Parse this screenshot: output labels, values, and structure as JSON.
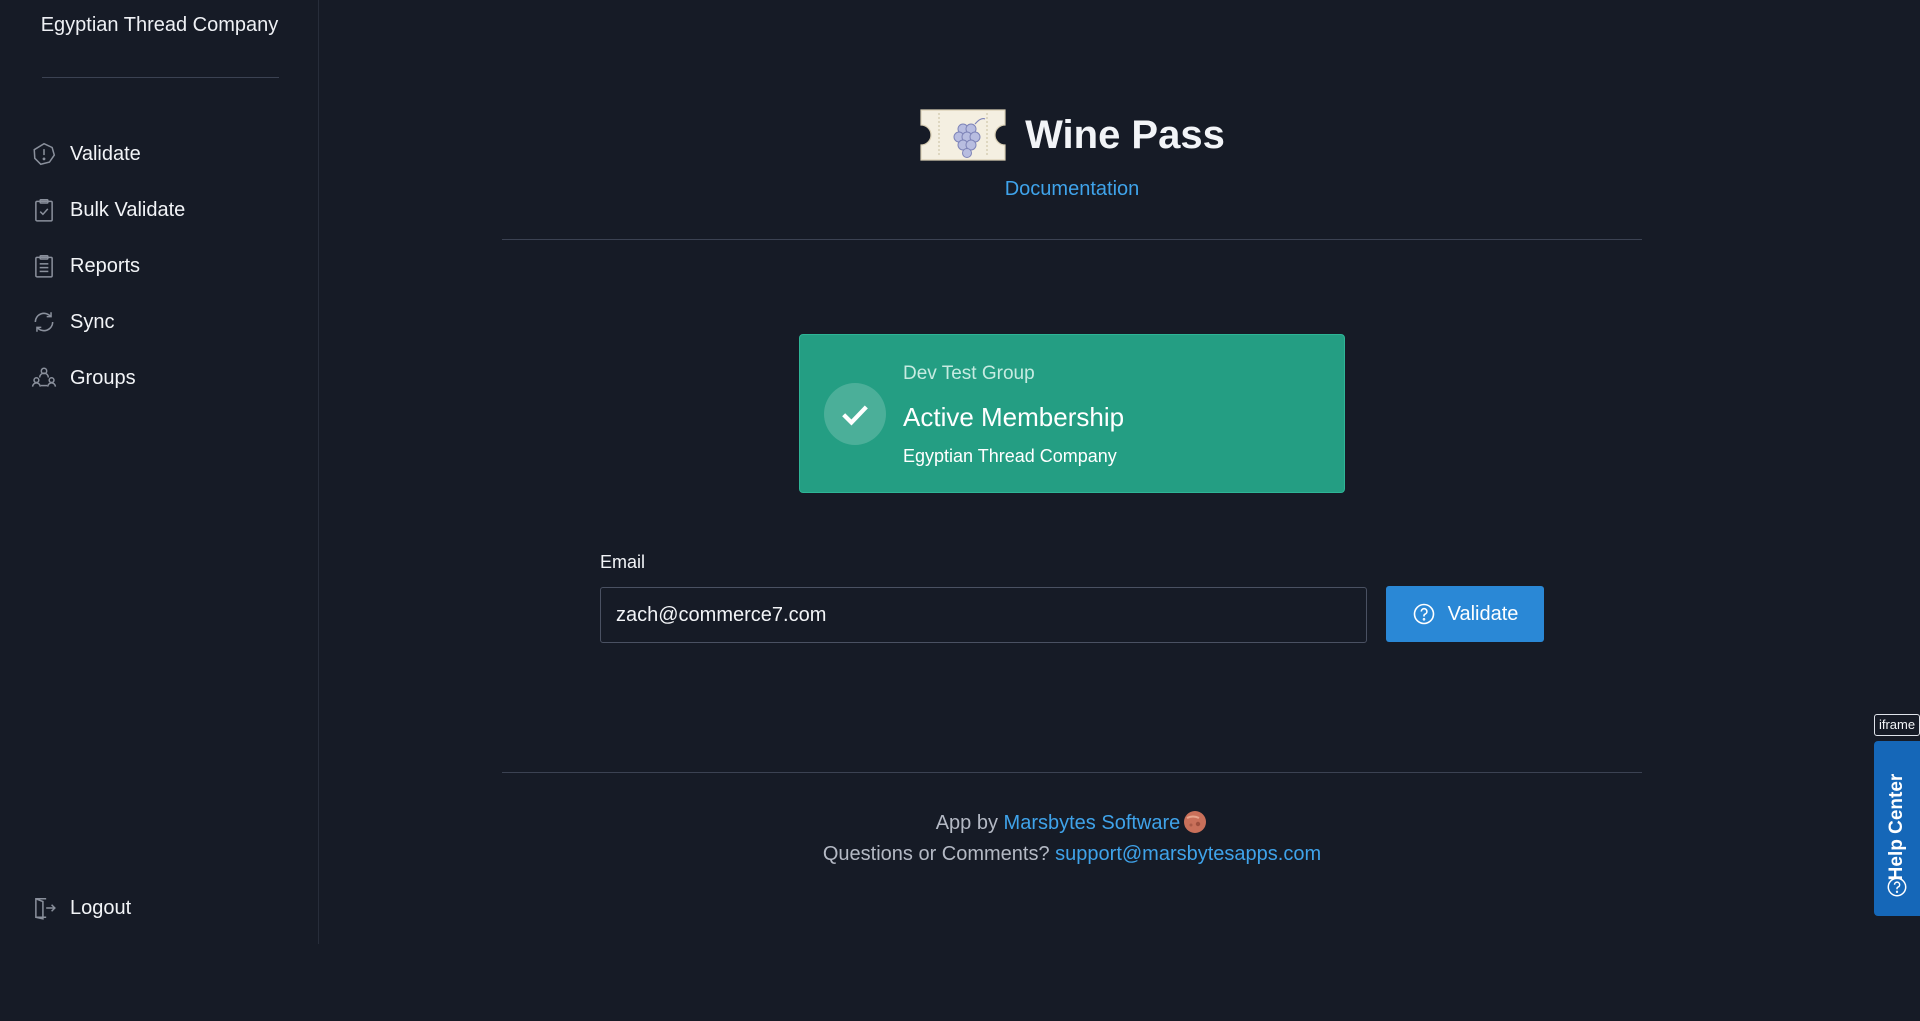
{
  "sidebar": {
    "company_name": "Egyptian Thread Company",
    "items": [
      {
        "label": "Validate",
        "icon": "alert-circle-icon"
      },
      {
        "label": "Bulk Validate",
        "icon": "clipboard-check-icon"
      },
      {
        "label": "Reports",
        "icon": "clipboard-list-icon"
      },
      {
        "label": "Sync",
        "icon": "sync-icon"
      },
      {
        "label": "Groups",
        "icon": "group-icon"
      }
    ],
    "logout_label": "Logout"
  },
  "header": {
    "title": "Wine Pass",
    "documentation_link": "Documentation"
  },
  "status": {
    "group": "Dev Test Group",
    "title": "Active Membership",
    "company": "Egyptian Thread Company",
    "color": "#249e83"
  },
  "form": {
    "email_label": "Email",
    "email_value": "zach@commerce7.com",
    "validate_label": "Validate"
  },
  "footer": {
    "app_by": "App by",
    "company_link": "Marsbytes Software",
    "questions": "Questions or Comments?",
    "support_email": "support@marsbytesapps.com"
  },
  "overlay": {
    "iframe_tag": "iframe",
    "help_center": "Help Center"
  },
  "colors": {
    "background": "#161b26",
    "accent": "#2a88d6",
    "link": "#3fa3ea",
    "help_center": "#1567b8"
  }
}
